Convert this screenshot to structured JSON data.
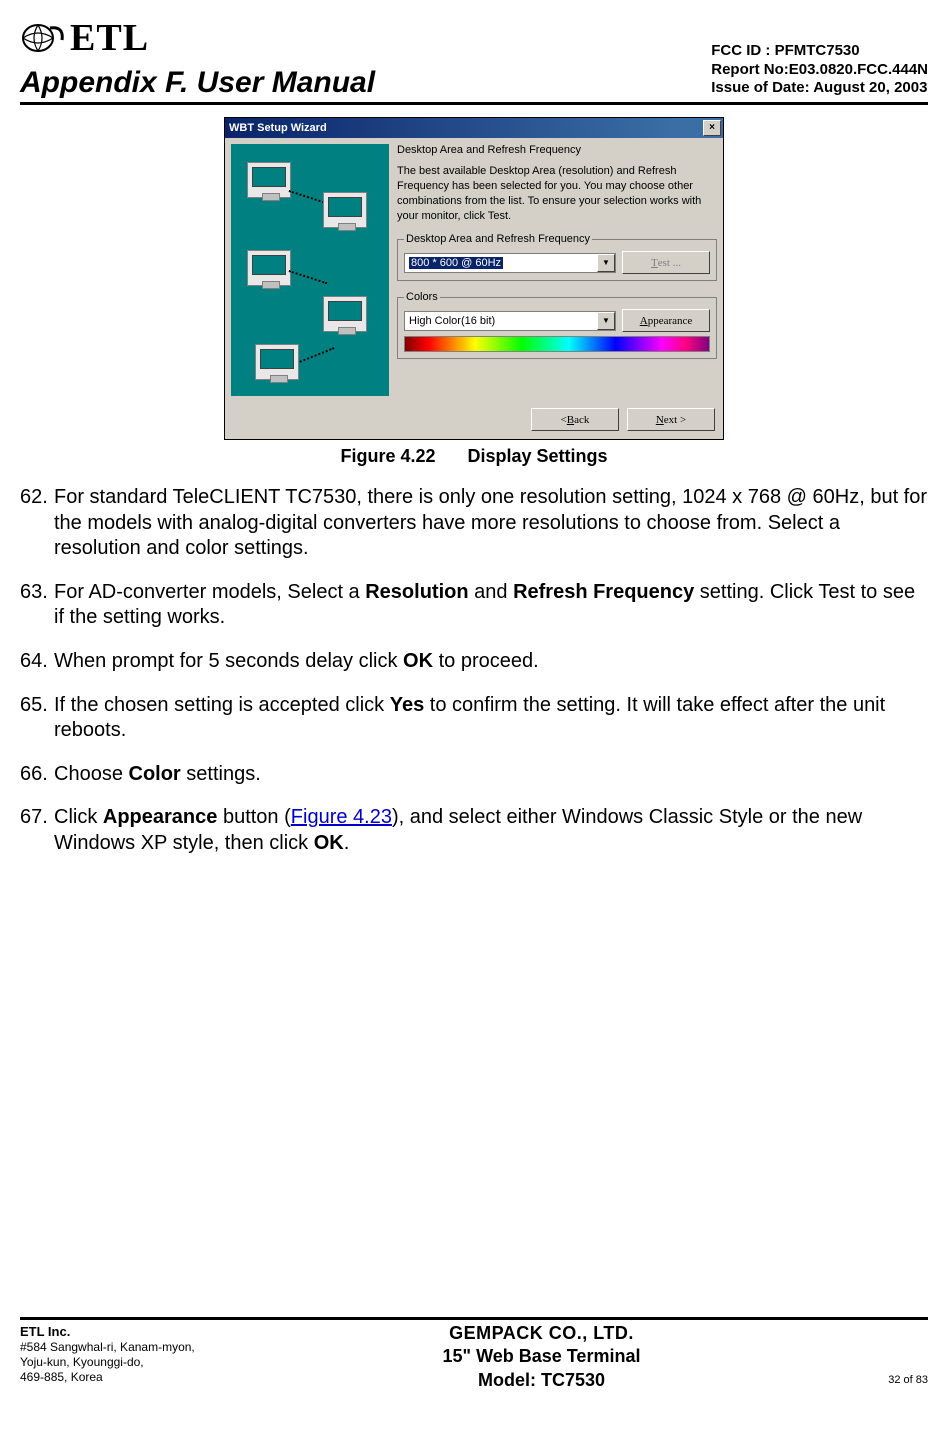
{
  "header": {
    "logo_text": "ETL",
    "title": "Appendix F. User Manual",
    "fcc_id": "FCC ID : PFMTC7530",
    "report_no": "Report No:E03.0820.FCC.444N",
    "issue_date": "Issue of Date:  August 20, 2003"
  },
  "dialog": {
    "title": "WBT Setup Wizard",
    "close": "×",
    "section_heading": "Desktop Area and Refresh Frequency",
    "description": "The best available Desktop Area (resolution) and Refresh Frequency has been selected for you.  You may choose other combinations from the list.  To ensure your selection works with your monitor, click Test.",
    "group1_legend": "Desktop Area and Refresh Frequency",
    "resolution_value": "800 * 600 @ 60Hz",
    "test_btn": "Test ...",
    "group2_legend": "Colors",
    "color_value": "High Color(16 bit)",
    "appearance_btn": "Appearance",
    "back_btn": "< Back",
    "next_btn": "Next >"
  },
  "figure": {
    "caption_prefix": "Figure 4.22",
    "caption_title": "Display Settings"
  },
  "steps": [
    {
      "num": "62.",
      "html": "For standard TeleCLIENT TC7530, there is only one resolution setting, 1024 x 768 @ 60Hz, but for the models with analog-digital converters have more resolutions to choose from.  Select a resolution and color settings."
    },
    {
      "num": "63.",
      "html": "For AD-converter models, Select a <span class='b'>Resolution</span> and <span class='b'>Refresh Frequency</span> setting.  Click Test to see if the setting works."
    },
    {
      "num": "64.",
      "html": "When prompt for 5 seconds delay click <span class='b'>OK</span> to proceed."
    },
    {
      "num": "65.",
      "html": "If the chosen setting is accepted click <span class='b'>Yes</span> to confirm the setting.  It will take effect after the unit reboots."
    },
    {
      "num": "66.",
      "html": "Choose <span class='b'>Color</span> settings."
    },
    {
      "num": "67.",
      "html": "Click <span class='b'>Appearance</span> button (<a class='figref' href='#'>Figure 4.23</a>), and select either Windows Classic Style or the new Windows XP style, then click <span class='b'>OK</span>."
    }
  ],
  "footer": {
    "company": "ETL Inc.",
    "addr1": "#584 Sangwhal-ri, Kanam-myon,",
    "addr2": "Yoju-kun, Kyounggi-do,",
    "addr3": "469-885, Korea",
    "center1": "GEMPACK CO., LTD.",
    "center2": "15\" Web Base Terminal",
    "center3": "Model: TC7530",
    "pager": "32 of  83"
  }
}
